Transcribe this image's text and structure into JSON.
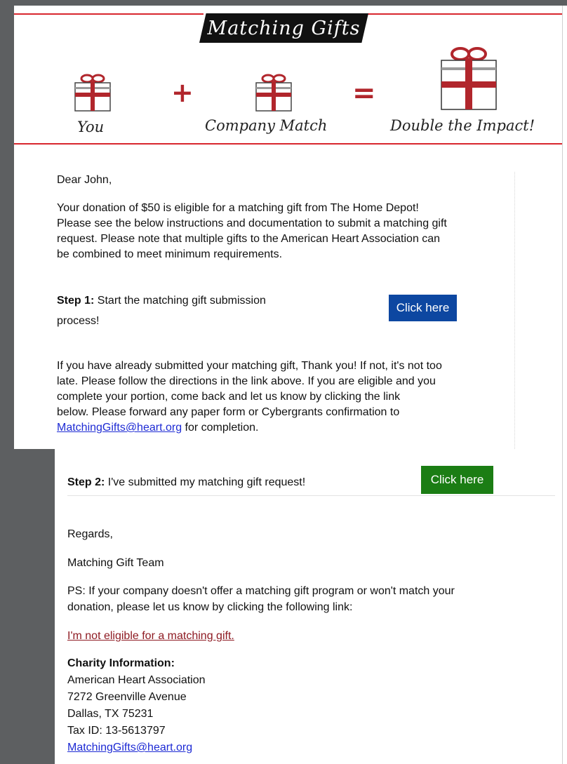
{
  "header": {
    "title": "Matching Gifts",
    "equation": {
      "you_label": "You",
      "company_label": "Company Match",
      "result_label": "Double the Impact!",
      "plus_symbol": "+",
      "equals_symbol": "="
    },
    "icons": [
      "gift-icon",
      "plus-icon",
      "gift-icon",
      "equals-icon",
      "gift-icon"
    ]
  },
  "email": {
    "greeting": "Dear John,",
    "intro": [
      "Your donation of $50 is eligible for a matching gift from The Home Depot!",
      "Please see the below instructions and documentation to submit a matching gift",
      "request.  Please note that multiple gifts to the American Heart Association can",
      "be combined to meet minimum requirements."
    ],
    "step1": {
      "label": "Step 1:",
      "text_line1": "Start the matching gift submission",
      "text_line2": "process!",
      "button": "Click here"
    },
    "already": {
      "lines": [
        "If you have already submitted your matching gift, Thank you!  If not, it's not too",
        "late.  Please follow the directions in the link above.  If you are eligible and you",
        "complete your portion, come back and let us know by clicking the link",
        "below.  Please forward any paper form or Cybergrants confirmation to"
      ],
      "email_link": "MatchingGifts@heart.org",
      "tail": " for completion."
    },
    "step2": {
      "label": "Step 2:",
      "text": "I've submitted my matching gift request!",
      "button": "Click here"
    },
    "regards": "Regards,",
    "team": "Matching Gift Team",
    "ps": [
      "PS: If your company doesn't offer a matching gift program or won't match your",
      "donation, please let us know by clicking the following link:"
    ],
    "not_eligible_link": "I'm not eligible for a matching gift.",
    "charity": {
      "heading": "Charity Information:",
      "name": "American Heart Association",
      "street": "7272 Greenville Avenue",
      "city": "Dallas, TX 75231",
      "tax_id": "Tax ID:  13-5613797",
      "email": "MatchingGifts@heart.org"
    }
  },
  "colors": {
    "accent_red": "#d8262e",
    "gift_red": "#b1262c",
    "button_blue": "#0d47a1",
    "button_green": "#1b7d14",
    "link_blue": "#1d2ad4",
    "link_dark_red": "#8e1a22",
    "backdrop": "#5d5f61"
  }
}
